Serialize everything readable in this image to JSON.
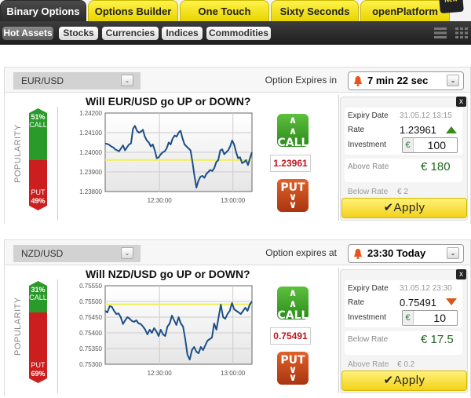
{
  "tabs": [
    {
      "label": "Binary Options",
      "active": true
    },
    {
      "label": "Options Builder",
      "active": false
    },
    {
      "label": "One Touch",
      "active": false
    },
    {
      "label": "Sixty Seconds",
      "active": false
    },
    {
      "label": "openPlatform",
      "active": false
    }
  ],
  "new_badge": "New",
  "categories": [
    {
      "label": "Hot Assets",
      "active": true
    },
    {
      "label": "Stocks",
      "active": false
    },
    {
      "label": "Currencies",
      "active": false
    },
    {
      "label": "Indices",
      "active": false
    },
    {
      "label": "Commodities",
      "active": false
    }
  ],
  "view_toggles": [
    "list-view-icon",
    "grid-view-icon"
  ],
  "panels": [
    {
      "asset": "EUR/USD",
      "expiry_label": "Option Expires in",
      "expiry_value": "7 min 22 sec",
      "popularity_label": "POPULARITY",
      "call_pct": "51%",
      "call_label": "CALL",
      "put_pct": "49%",
      "put_label": "PUT",
      "call_fraction": 0.51,
      "question": "Will EUR/USD go UP or DOWN?",
      "current_rate": "1.23961",
      "call_button": "CALL",
      "put_button": "PUT",
      "ticket": {
        "expiry_date_label": "Expiry Date",
        "expiry_date": "31.05.12 13:15",
        "rate_label": "Rate",
        "rate": "1.23961",
        "direction": "up",
        "investment_label": "Investment",
        "currency": "€",
        "investment": "100",
        "primary_payout_label": "Above Rate",
        "primary_payout": "€ 180",
        "secondary_payout_label": "Below Rate",
        "secondary_payout": "€ 2",
        "apply_label": "✔Apply",
        "close": "x"
      },
      "chart_data": {
        "type": "line",
        "ylim": [
          1.238,
          1.242
        ],
        "yticks": [
          "1.24200",
          "1.24100",
          "1.24000",
          "1.23900",
          "1.23800"
        ],
        "xticks": [
          {
            "label": "12:30:00",
            "pos": 0.37
          },
          {
            "label": "13:00:00",
            "pos": 0.87
          }
        ],
        "strike": 1.23961,
        "series": [
          1.24045,
          1.24043,
          1.24038,
          1.2403,
          1.24025,
          1.24015,
          1.2401,
          1.24005,
          1.2402,
          1.24035,
          1.2401,
          1.24025,
          1.2404,
          1.24045,
          1.2412,
          1.24135,
          1.2411,
          1.241,
          1.24105,
          1.24115,
          1.2408,
          1.2406,
          1.2405,
          1.2403,
          1.2404,
          1.2401,
          1.2397,
          1.23975,
          1.2399,
          1.24,
          1.24005,
          1.2402,
          1.2405,
          1.2404,
          1.2407,
          1.24085,
          1.2408,
          1.241,
          1.2411,
          1.2407,
          1.2404,
          1.2403,
          1.2402,
          1.2401,
          1.2395,
          1.2388,
          1.2382,
          1.23855,
          1.23875,
          1.2388,
          1.2387,
          1.2389,
          1.239,
          1.2391,
          1.23905,
          1.2392,
          1.2395,
          1.2396,
          1.2401,
          1.24015,
          1.2399,
          1.24,
          1.2401,
          1.2403,
          1.2406,
          1.2404,
          1.24,
          1.2397,
          1.23975,
          1.23945,
          1.2395,
          1.2396,
          1.23935,
          1.2397,
          1.24
        ]
      }
    },
    {
      "asset": "NZD/USD",
      "expiry_label": "Option expires at",
      "expiry_value": "23:30 Today",
      "popularity_label": "POPULARITY",
      "call_pct": "31%",
      "call_label": "CALL",
      "put_pct": "69%",
      "put_label": "PUT",
      "call_fraction": 0.31,
      "question": "Will NZD/USD go UP or DOWN?",
      "current_rate": "0.75491",
      "call_button": "CALL",
      "put_button": "PUT",
      "ticket": {
        "expiry_date_label": "Expiry Date",
        "expiry_date": "31.05.12 23:30",
        "rate_label": "Rate",
        "rate": "0.75491",
        "direction": "down",
        "investment_label": "Investment",
        "currency": "€",
        "investment": "10",
        "primary_payout_label": "Below Rate",
        "primary_payout": "€ 17.5",
        "secondary_payout_label": "Above Rate",
        "secondary_payout": "€ 0.2",
        "apply_label": "✔Apply",
        "close": "x"
      },
      "chart_data": {
        "type": "line",
        "ylim": [
          0.753,
          0.7555
        ],
        "yticks": [
          "0.75550",
          "0.75500",
          "0.75450",
          "0.75400",
          "0.75350",
          "0.75300"
        ],
        "xticks": [
          {
            "label": "12:30:00",
            "pos": 0.37
          },
          {
            "label": "13:00:00",
            "pos": 0.87
          }
        ],
        "strike": 0.75491,
        "series": [
          0.7547,
          0.75465,
          0.75485,
          0.75483,
          0.7547,
          0.7546,
          0.75462,
          0.7545,
          0.75428,
          0.7544,
          0.7545,
          0.75445,
          0.75438,
          0.75435,
          0.7544,
          0.7543,
          0.75428,
          0.7542,
          0.7541,
          0.75395,
          0.7541,
          0.754,
          0.75415,
          0.75405,
          0.7539,
          0.7541,
          0.75395,
          0.7539,
          0.7542,
          0.7543,
          0.75455,
          0.7544,
          0.75425,
          0.7545,
          0.7543,
          0.7542,
          0.7538,
          0.7533,
          0.75315,
          0.75345,
          0.75355,
          0.7534,
          0.75335,
          0.75355,
          0.75345,
          0.7536,
          0.75375,
          0.7538,
          0.75385,
          0.7543,
          0.7541,
          0.7545,
          0.7549,
          0.7545,
          0.75445,
          0.7546,
          0.7547,
          0.75495,
          0.75475,
          0.7547,
          0.75465,
          0.7546,
          0.7547,
          0.7548,
          0.7547,
          0.7549,
          0.755
        ]
      }
    }
  ]
}
